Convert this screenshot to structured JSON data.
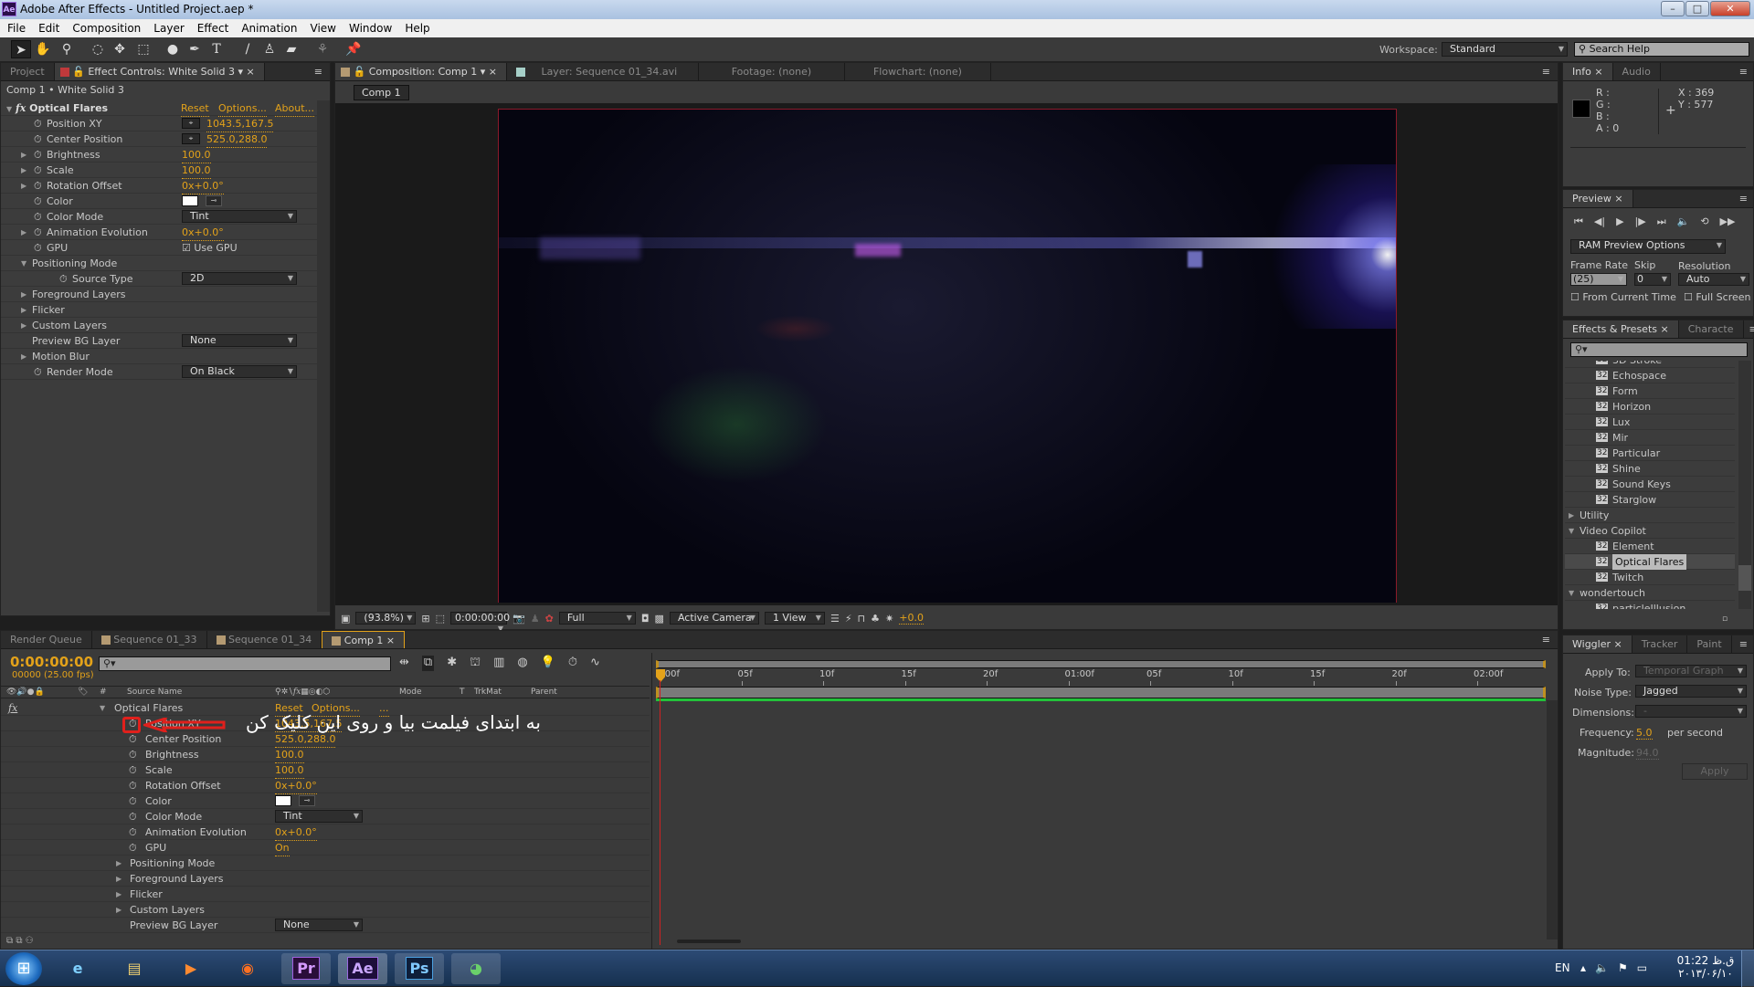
{
  "window": {
    "title": "Adobe After Effects - Untitled Project.aep *",
    "app_icon": "Ae"
  },
  "menu": [
    "File",
    "Edit",
    "Composition",
    "Layer",
    "Effect",
    "Animation",
    "View",
    "Window",
    "Help"
  ],
  "toolbar": {
    "tools": [
      "selection-tool",
      "hand-tool",
      "zoom-tool",
      "rotate-tool",
      "camera-orbit-tool",
      "pan-behind-tool",
      "ellipse-tool",
      "pen-tool",
      "type-tool",
      "brush-tool",
      "clone-stamp-tool",
      "eraser-tool",
      "roto-brush-tool",
      "puppet-pin-tool"
    ],
    "workspace_label": "Workspace:",
    "workspace_value": "Standard",
    "search_placeholder": "Search Help"
  },
  "effect_controls": {
    "tabs": {
      "project": "Project",
      "effect_controls": "Effect Controls: White Solid 3"
    },
    "breadcrumb": "Comp 1 • White Solid 3",
    "effect_name": "Optical Flares",
    "reset": "Reset",
    "options": "Options...",
    "about": "About...",
    "rows": [
      {
        "label": "Position XY",
        "value": "1043.5,167.5"
      },
      {
        "label": "Center Position",
        "value": "525.0,288.0"
      },
      {
        "label": "Brightness",
        "value": "100.0"
      },
      {
        "label": "Scale",
        "value": "100.0"
      },
      {
        "label": "Rotation Offset",
        "value": "0x+0.0°"
      },
      {
        "label": "Color",
        "value": ""
      },
      {
        "label": "Color Mode",
        "value": "Tint"
      },
      {
        "label": "Animation Evolution",
        "value": "0x+0.0°"
      },
      {
        "label": "GPU",
        "value": "Use GPU"
      },
      {
        "label": "Positioning Mode",
        "value": ""
      },
      {
        "label": "Source Type",
        "value": "2D"
      },
      {
        "label": "Foreground Layers",
        "value": ""
      },
      {
        "label": "Flicker",
        "value": ""
      },
      {
        "label": "Custom Layers",
        "value": ""
      },
      {
        "label": "Preview BG Layer",
        "value": "None"
      },
      {
        "label": "Motion Blur",
        "value": ""
      },
      {
        "label": "Render Mode",
        "value": "On Black"
      }
    ]
  },
  "viewer": {
    "tabs": {
      "composition": "Composition: Comp 1",
      "layer": "Layer: Sequence 01_34.avi",
      "footage": "Footage: (none)",
      "flowchart": "Flowchart: (none)"
    },
    "breadcrumb": "Comp 1",
    "zoom": "(93.8%)",
    "timecode": "0:00:00:00",
    "resolution": "Full",
    "camera": "Active Camera",
    "views": "1 View",
    "exposure": "+0.0"
  },
  "info": {
    "tabs": [
      "Info",
      "Audio"
    ],
    "r": "R :",
    "g": "G :",
    "b": "B :",
    "a": "A : 0",
    "x": "X : 369",
    "y": "Y : 577"
  },
  "preview": {
    "tab": "Preview",
    "ram_options": "RAM Preview Options",
    "frame_rate_label": "Frame Rate",
    "frame_rate": "(25)",
    "skip_label": "Skip",
    "skip": "0",
    "resolution_label": "Resolution",
    "resolution": "Auto",
    "from_current": "From Current Time",
    "full_screen": "Full Screen"
  },
  "effects_presets": {
    "tabs": [
      "Effects & Presets",
      "Characte"
    ],
    "items": [
      {
        "label": "3D Stroke",
        "type": "effect"
      },
      {
        "label": "Echospace",
        "type": "effect"
      },
      {
        "label": "Form",
        "type": "effect"
      },
      {
        "label": "Horizon",
        "type": "effect"
      },
      {
        "label": "Lux",
        "type": "effect"
      },
      {
        "label": "Mir",
        "type": "effect"
      },
      {
        "label": "Particular",
        "type": "effect"
      },
      {
        "label": "Shine",
        "type": "effect"
      },
      {
        "label": "Sound Keys",
        "type": "effect"
      },
      {
        "label": "Starglow",
        "type": "effect"
      },
      {
        "label": "Utility",
        "type": "folder-collapsed"
      },
      {
        "label": "Video Copilot",
        "type": "folder-open"
      },
      {
        "label": "Element",
        "type": "effect"
      },
      {
        "label": "Optical Flares",
        "type": "effect",
        "selected": true
      },
      {
        "label": "Twitch",
        "type": "effect"
      },
      {
        "label": "wondertouch",
        "type": "folder-open"
      },
      {
        "label": "particleIllusion",
        "type": "effect"
      }
    ]
  },
  "wiggler": {
    "tabs": [
      "Wiggler",
      "Tracker",
      "Paint"
    ],
    "apply_to_label": "Apply To:",
    "apply_to": "Temporal Graph",
    "noise_label": "Noise Type:",
    "noise": "Jagged",
    "dimensions_label": "Dimensions:",
    "dimensions": "-",
    "frequency_label": "Frequency:",
    "frequency": "5.0",
    "per_second": "per second",
    "magnitude_label": "Magnitude:",
    "magnitude": "94.0",
    "apply": "Apply"
  },
  "timeline": {
    "tabs": [
      "Render Queue",
      "Sequence 01_33",
      "Sequence 01_34",
      "Comp 1"
    ],
    "timecode": "0:00:00:00",
    "fps": "00000 (25.00 fps)",
    "columns": {
      "num": "#",
      "source": "Source Name",
      "mode": "Mode",
      "t": "T",
      "trkmat": "TrkMat",
      "parent": "Parent"
    },
    "effect": "Optical Flares",
    "reset": "Reset",
    "options": "Options...",
    "dots": "...",
    "rows": [
      {
        "label": "Position XY",
        "value": "1043.5,167.5"
      },
      {
        "label": "Center Position",
        "value": "525.0,288.0"
      },
      {
        "label": "Brightness",
        "value": "100.0"
      },
      {
        "label": "Scale",
        "value": "100.0"
      },
      {
        "label": "Rotation Offset",
        "value": "0x+0.0°"
      },
      {
        "label": "Color",
        "value": ""
      },
      {
        "label": "Color Mode",
        "value": "Tint"
      },
      {
        "label": "Animation Evolution",
        "value": "0x+0.0°"
      },
      {
        "label": "GPU",
        "value": "On"
      },
      {
        "label": "Positioning Mode",
        "value": ""
      },
      {
        "label": "Foreground Layers",
        "value": ""
      },
      {
        "label": "Flicker",
        "value": ""
      },
      {
        "label": "Custom Layers",
        "value": ""
      },
      {
        "label": "Preview BG Layer",
        "value": "None"
      }
    ],
    "ruler": [
      "0:00f",
      "05f",
      "10f",
      "15f",
      "20f",
      "01:00f",
      "05f",
      "10f",
      "15f",
      "20f",
      "02:00f"
    ],
    "annotation": "به ابتدای فیلمت بیا و روی این کلیک کن"
  },
  "taskbar": {
    "apps": [
      "start",
      "internet-explorer",
      "explorer",
      "media-player",
      "firefox",
      "Pr",
      "Ae",
      "Ps",
      "chrome"
    ],
    "lang": "EN",
    "time": "01:22 ق.ظ",
    "date": "۲۰۱۳/۰۶/۱۰"
  },
  "colors": {
    "accent": "#e3a21a",
    "panel": "#3c3c3c",
    "annotation": "#e0201c",
    "workarea": "#22c23a"
  }
}
